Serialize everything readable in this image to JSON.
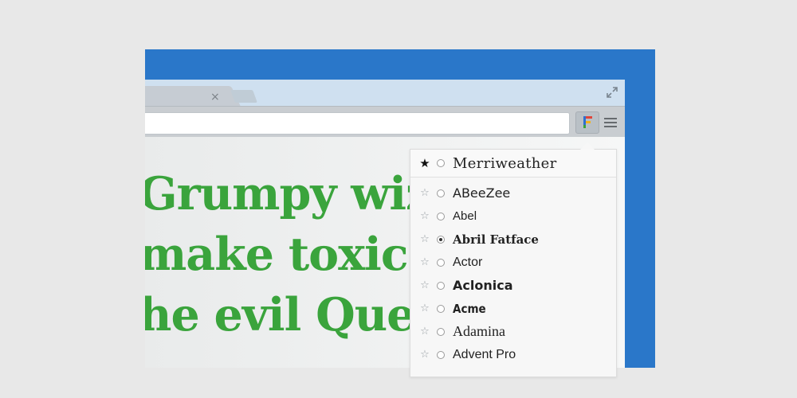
{
  "browser": {
    "tab_close": "×"
  },
  "page": {
    "hero_lines": [
      "Grumpy wiz",
      "make toxic b",
      "he evil Quee"
    ],
    "text_color": "#3aa43c"
  },
  "font_popup": {
    "pinned": {
      "star": "★",
      "name": "Merriweather"
    },
    "fonts": [
      {
        "star": "☆",
        "name": "ABeeZee",
        "selected": false
      },
      {
        "star": "☆",
        "name": "Abel",
        "selected": false
      },
      {
        "star": "☆",
        "name": "Abril Fatface",
        "selected": true
      },
      {
        "star": "☆",
        "name": "Actor",
        "selected": false
      },
      {
        "star": "☆",
        "name": "Aclonica",
        "selected": false
      },
      {
        "star": "☆",
        "name": "Acme",
        "selected": false
      },
      {
        "star": "☆",
        "name": "Adamina",
        "selected": false
      },
      {
        "star": "☆",
        "name": "Advent Pro",
        "selected": false
      }
    ]
  },
  "colors": {
    "background": "#e8e8e8",
    "accent_blue": "#2a77c9",
    "tabstrip": "#cfe0f0",
    "toolbar": "#c9cdd1"
  },
  "icons": {
    "restore": "restore-window-icon",
    "extension": "font-changer-extension-icon",
    "menu": "hamburger-menu-icon"
  }
}
